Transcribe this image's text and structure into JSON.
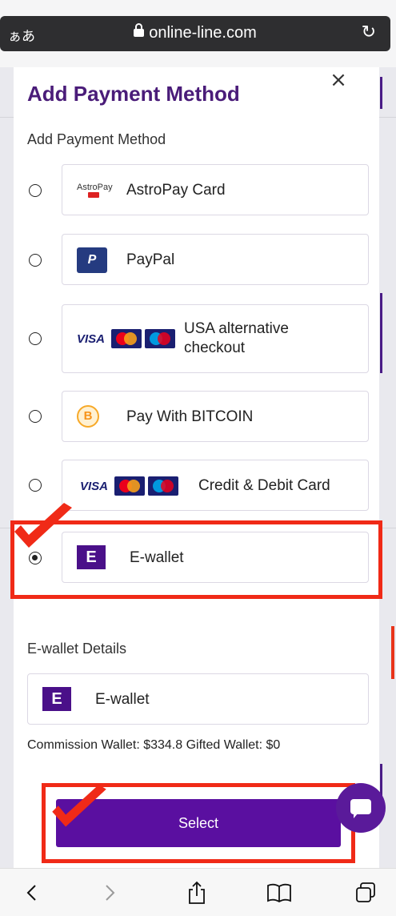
{
  "browser": {
    "text_size_label": "ぁあ",
    "url": "online-line.com",
    "reload_icon": "reload-icon"
  },
  "modal": {
    "title": "Add Payment Method",
    "close_symbol": "×",
    "section_label": "Add Payment Method",
    "options": [
      {
        "label": "AstroPay Card",
        "logo": "astropay-logo",
        "selected": false
      },
      {
        "label": "PayPal",
        "logo": "paypal-logo",
        "selected": false
      },
      {
        "label": "USA alternative checkout",
        "logo": "visa-mastercard-maestro-logos",
        "selected": false
      },
      {
        "label": "Pay With BITCOIN",
        "logo": "bitcoin-logo",
        "selected": false
      },
      {
        "label": "Credit & Debit Card",
        "logo": "visa-mastercard-maestro-logos",
        "selected": false
      },
      {
        "label": "E-wallet",
        "logo": "ewallet-logo",
        "selected": true
      }
    ],
    "logo_text": {
      "astropay": "AstroPay",
      "paypal": "P",
      "visa": "VISA",
      "bitcoin": "B",
      "ewallet": "E"
    },
    "details": {
      "title": "E-wallet Details",
      "wallet_label": "E-wallet",
      "commission": "Commission Wallet: $334.8 Gifted Wallet: $0"
    },
    "select_label": "Select"
  },
  "annotations": {
    "highlight_color": "#f02a17"
  },
  "toolbar": {
    "back_icon": "back-icon",
    "forward_icon": "forward-icon",
    "share_icon": "share-icon",
    "bookmarks_icon": "bookmarks-icon",
    "tabs_icon": "tabs-icon"
  }
}
